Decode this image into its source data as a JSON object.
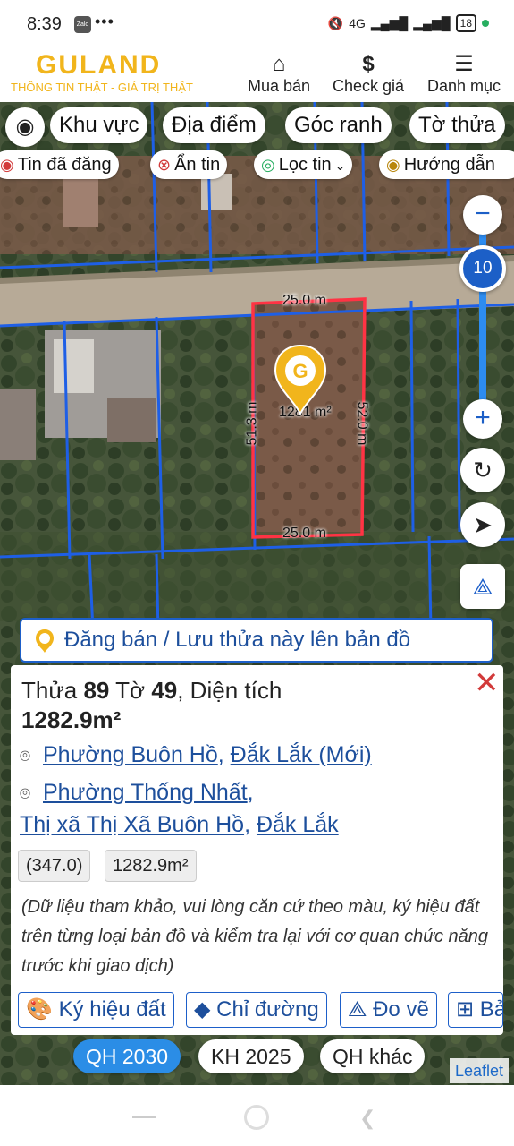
{
  "status": {
    "time": "8:39",
    "zalo": "Zalo",
    "dots": "•••",
    "network": "4G",
    "battery": "18"
  },
  "header": {
    "logo": "GULAND",
    "tagline": "THÔNG TIN THẬT - GIÁ TRỊ THẬT",
    "nav": [
      {
        "label": "Mua bán",
        "icon": "house-icon"
      },
      {
        "label": "Check giá",
        "icon": "dollar-icon"
      },
      {
        "label": "Danh mục",
        "icon": "menu-icon"
      }
    ]
  },
  "filters": {
    "area": "Khu vực",
    "place": "Địa điểm",
    "corner": "Góc ranh",
    "sheet": "Tờ thửa"
  },
  "chips": {
    "posted": "Tin đã đăng",
    "hide": "Ẩn tin",
    "filter": "Lọc tin",
    "guide": "Hướng dẫn"
  },
  "map": {
    "zoom_level": "10",
    "plot": {
      "top_len": "25.0 m",
      "bottom_len": "25.0 m",
      "left_len": "51.3 m",
      "right_len": "52.0 m",
      "area": "1281 m²"
    }
  },
  "post_banner": "Đăng bán / Lưu thửa này lên bản đồ",
  "info": {
    "plot_label": "Thửa",
    "plot_no": "89",
    "sheet_label": "Tờ",
    "sheet_no": "49",
    "area_label": ", Diện tích",
    "area": "1282.9m²",
    "new_ward": "Phường Buôn Hồ",
    "new_province": "Đắk Lắk (Mới)",
    "old_ward": "Phường Thống Nhất",
    "old_town": "Thị xã Thị Xã Buôn Hồ",
    "old_province": "Đắk Lắk",
    "tag1": "(347.0)",
    "tag2": "1282.9m²",
    "note": "(Dữ liệu tham khảo, vui lòng căn cứ theo màu, ký hiệu đất trên từng loại bản đồ và kiểm tra lại với cơ quan chức năng trước khi giao dịch)",
    "actions": {
      "symbols": "Ký hiệu đất",
      "directions": "Chỉ đường",
      "measure": "Đo vẽ",
      "more": "Bả"
    }
  },
  "plans": {
    "qh2030": "QH 2030",
    "kh2025": "KH 2025",
    "other": "QH khác"
  },
  "attribution": "Leaflet"
}
